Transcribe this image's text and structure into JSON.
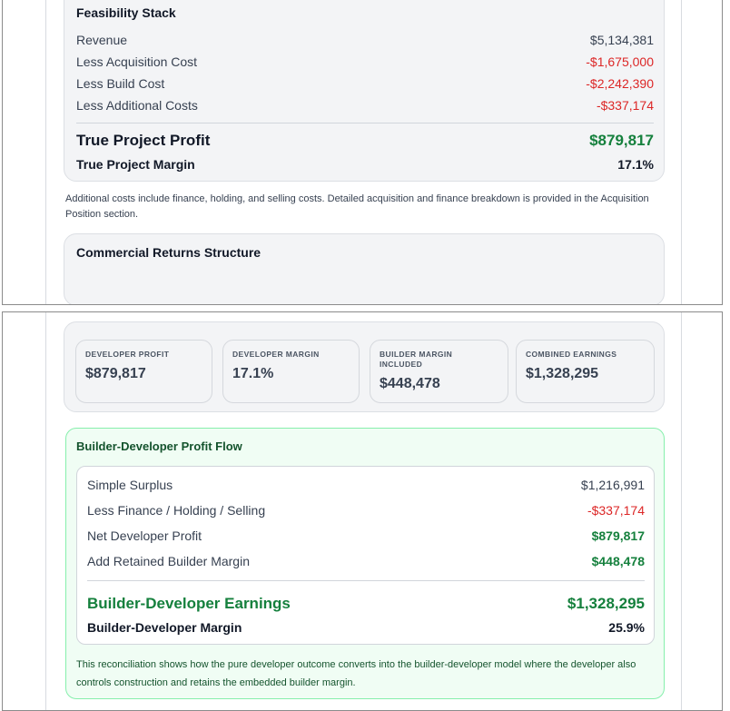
{
  "feasibility": {
    "title": "Feasibility Stack",
    "rows": [
      {
        "label": "Revenue",
        "value": "$5,134,381"
      },
      {
        "label": "Less Acquisition Cost",
        "value": "-$1,675,000"
      },
      {
        "label": "Less Build Cost",
        "value": "-$2,242,390"
      },
      {
        "label": "Less Additional Costs",
        "value": "-$337,174"
      }
    ],
    "profit": {
      "label": "True Project Profit",
      "value": "$879,817"
    },
    "margin": {
      "label": "True Project Margin",
      "value": "17.1%"
    }
  },
  "note": "Additional costs include finance, holding, and selling costs. Detailed acquisition and finance breakdown is provided in the Acquisition Position section.",
  "returns": {
    "title": "Commercial Returns Structure",
    "metrics": [
      {
        "label": "DEVELOPER PROFIT",
        "value": "$879,817"
      },
      {
        "label": "DEVELOPER MARGIN",
        "value": "17.1%"
      },
      {
        "label": "BUILDER MARGIN INCLUDED",
        "value": "$448,478"
      },
      {
        "label": "COMBINED EARNINGS",
        "value": "$1,328,295"
      }
    ]
  },
  "flow": {
    "title": "Builder-Developer Profit Flow",
    "rows": [
      {
        "label": "Simple Surplus",
        "value": "$1,216,991"
      },
      {
        "label": "Less Finance / Holding / Selling",
        "value": "-$337,174"
      },
      {
        "label": "Net Developer Profit",
        "value": "$879,817"
      },
      {
        "label": "Add Retained Builder Margin",
        "value": "$448,478"
      }
    ],
    "earnings": {
      "label": "Builder-Developer Earnings",
      "value": "$1,328,295"
    },
    "margin": {
      "label": "Builder-Developer Margin",
      "value": "25.9%"
    },
    "note": "This reconciliation shows how the pure developer outcome converts into the builder-developer model where the developer also controls construction and retains the embedded builder margin."
  },
  "colors": {
    "negative": "#dc2626",
    "positive": "#15803d",
    "flow_bg": "#f0fdf4",
    "flow_border": "#86efac"
  }
}
